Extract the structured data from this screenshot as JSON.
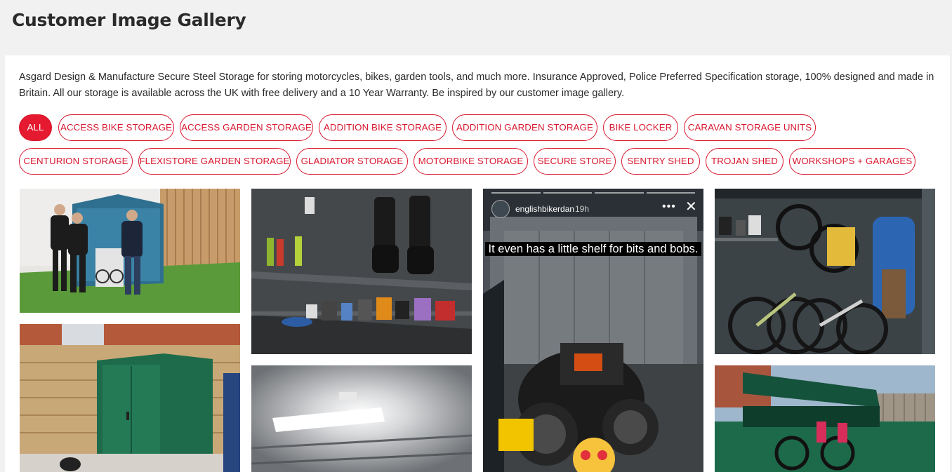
{
  "page": {
    "title": "Customer Image Gallery"
  },
  "intro": "Asgard Design & Manufacture Secure Steel Storage for storing motorcycles, bikes, garden tools, and much more. Insurance Approved, Police Preferred Specification storage, 100% designed and made in Britain. All our storage is available across the UK with free delivery and a 10 Year Warranty. Be inspired by our customer image gallery.",
  "filters": [
    {
      "label": "ALL",
      "active": true
    },
    {
      "label": "ACCESS BIKE STORAGE",
      "active": false
    },
    {
      "label": "ACCESS GARDEN STORAGE",
      "active": false
    },
    {
      "label": "ADDITION BIKE STORAGE",
      "active": false
    },
    {
      "label": "ADDITION GARDEN STORAGE",
      "active": false
    },
    {
      "label": "BIKE LOCKER",
      "active": false
    },
    {
      "label": "CARAVAN STORAGE UNITS",
      "active": false
    },
    {
      "label": "CENTURION STORAGE",
      "active": false
    },
    {
      "label": "FLEXISTORE GARDEN STORAGE",
      "active": false
    },
    {
      "label": "GLADIATOR STORAGE",
      "active": false
    },
    {
      "label": "MOTORBIKE STORAGE",
      "active": false
    },
    {
      "label": "SECURE STORE",
      "active": false
    },
    {
      "label": "SENTRY SHED",
      "active": false
    },
    {
      "label": "TROJAN SHED",
      "active": false
    },
    {
      "label": "WORKSHOPS + GARAGES",
      "active": false
    }
  ],
  "story": {
    "username": "englishbikerdan",
    "time": "19h",
    "caption": "It even has a little shelf for bits and bobs."
  },
  "colors": {
    "accent": "#e5192f",
    "background": "#f2f1f1"
  }
}
